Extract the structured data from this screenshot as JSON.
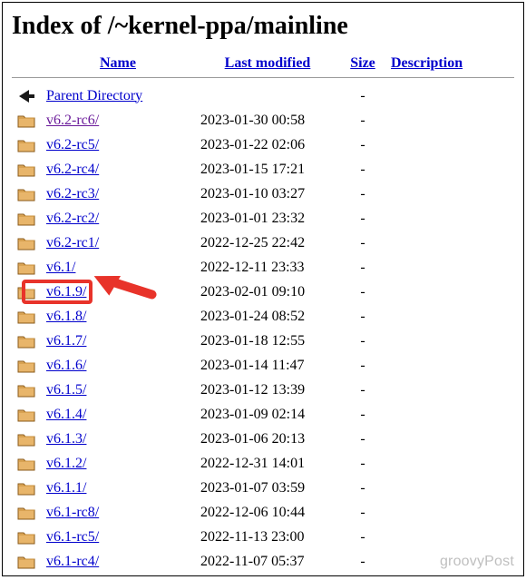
{
  "page_title": "Index of /~kernel-ppa/mainline",
  "headers": {
    "name": "Name",
    "last_modified": "Last modified",
    "size": "Size",
    "description": "Description"
  },
  "parent": {
    "label": "Parent Directory",
    "size": "-"
  },
  "rows": [
    {
      "name": "v6.2-rc6/",
      "modified": "2023-01-30 00:58",
      "size": "-",
      "visited": true
    },
    {
      "name": "v6.2-rc5/",
      "modified": "2023-01-22 02:06",
      "size": "-",
      "visited": false
    },
    {
      "name": "v6.2-rc4/",
      "modified": "2023-01-15 17:21",
      "size": "-",
      "visited": false
    },
    {
      "name": "v6.2-rc3/",
      "modified": "2023-01-10 03:27",
      "size": "-",
      "visited": false
    },
    {
      "name": "v6.2-rc2/",
      "modified": "2023-01-01 23:32",
      "size": "-",
      "visited": false
    },
    {
      "name": "v6.2-rc1/",
      "modified": "2022-12-25 22:42",
      "size": "-",
      "visited": false
    },
    {
      "name": "v6.1/",
      "modified": "2022-12-11 23:33",
      "size": "-",
      "visited": false
    },
    {
      "name": "v6.1.9/",
      "modified": "2023-02-01 09:10",
      "size": "-",
      "visited": false,
      "highlighted": true
    },
    {
      "name": "v6.1.8/",
      "modified": "2023-01-24 08:52",
      "size": "-",
      "visited": false
    },
    {
      "name": "v6.1.7/",
      "modified": "2023-01-18 12:55",
      "size": "-",
      "visited": false
    },
    {
      "name": "v6.1.6/",
      "modified": "2023-01-14 11:47",
      "size": "-",
      "visited": false
    },
    {
      "name": "v6.1.5/",
      "modified": "2023-01-12 13:39",
      "size": "-",
      "visited": false
    },
    {
      "name": "v6.1.4/",
      "modified": "2023-01-09 02:14",
      "size": "-",
      "visited": false
    },
    {
      "name": "v6.1.3/",
      "modified": "2023-01-06 20:13",
      "size": "-",
      "visited": false
    },
    {
      "name": "v6.1.2/",
      "modified": "2022-12-31 14:01",
      "size": "-",
      "visited": false
    },
    {
      "name": "v6.1.1/",
      "modified": "2023-01-07 03:59",
      "size": "-",
      "visited": false
    },
    {
      "name": "v6.1-rc8/",
      "modified": "2022-12-06 10:44",
      "size": "-",
      "visited": false
    },
    {
      "name": "v6.1-rc5/",
      "modified": "2022-11-13 23:00",
      "size": "-",
      "visited": false
    },
    {
      "name": "v6.1-rc4/",
      "modified": "2022-11-07 05:37",
      "size": "-",
      "visited": false
    }
  ],
  "annotation": {
    "arrow_color": "#e8332a",
    "highlight_target": "v6.1.9/"
  },
  "watermark": "groovyPost"
}
